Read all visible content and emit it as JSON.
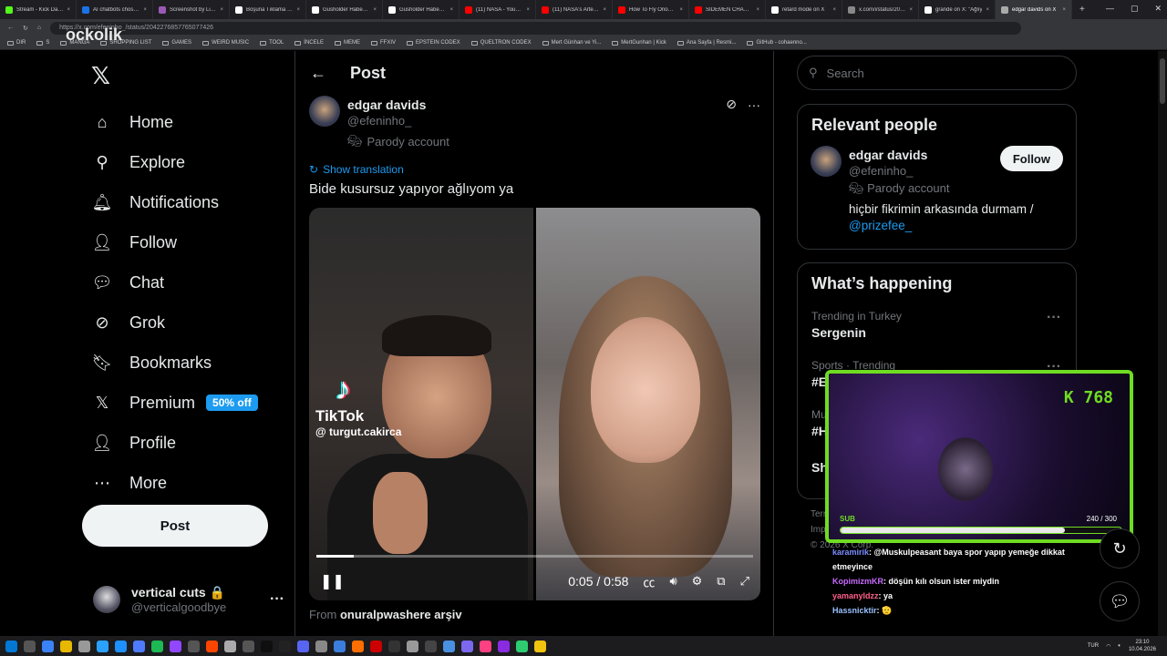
{
  "browser": {
    "tabs": [
      {
        "title": "Stream - Kick Dashb",
        "color": "#53fc18"
      },
      {
        "title": "AI chatbots chose n",
        "color": "#1a73e8"
      },
      {
        "title": "Screenshot by Lightsh",
        "color": "#9b59b6"
      },
      {
        "title": "Boşuna Tıklama on X",
        "color": "#ffffff"
      },
      {
        "title": "Gusholder Haber Bü",
        "color": "#ffffff"
      },
      {
        "title": "Gusholder Haber Bü",
        "color": "#ffffff"
      },
      {
        "title": "(11) NASA - YouTube",
        "color": "#ff0000"
      },
      {
        "title": "(11) NASA's Artemis",
        "color": "#ff0000"
      },
      {
        "title": "How To Fly Orion - Y",
        "color": "#ff0000"
      },
      {
        "title": "SIDEMEN CHARITY M",
        "color": "#ff0000"
      },
      {
        "title": "retard mode on X",
        "color": "#ffffff"
      },
      {
        "title": "x.com/i/status/2042",
        "color": "#888888"
      },
      {
        "title": "grande on X: \"Ağlıy",
        "color": "#ffffff"
      },
      {
        "title": "edgar davids on X",
        "color": "#aaaaaa"
      }
    ],
    "url": "https://x.com/efeninho_/status/2042276857765077426",
    "bookmarks": [
      "DIR",
      "S",
      "MANGA",
      "SHOPPING LIST",
      "GAMES",
      "WEIRD MUSIC",
      "TOOL",
      "İNCELE",
      "MEME",
      "FFXIV",
      "EPSTEIN CODEX",
      "QUELTRON CODEX",
      "Mert Günhan ve Yi...",
      "MertGunhan | Kick",
      "Ana Sayfa | Resmi...",
      "GitHub - cohaenno..."
    ],
    "overlay_logo": "ockolik"
  },
  "sidebar": {
    "logo": "𝕏",
    "items": [
      {
        "label": "Home",
        "icon": "home-icon",
        "glyph": "⌂"
      },
      {
        "label": "Explore",
        "icon": "search-icon",
        "glyph": "⚲"
      },
      {
        "label": "Notifications",
        "icon": "bell-icon",
        "glyph": "🔔︎"
      },
      {
        "label": "Follow",
        "icon": "add-person-icon",
        "glyph": "👤︎"
      },
      {
        "label": "Chat",
        "icon": "chat-icon",
        "glyph": "💬︎"
      },
      {
        "label": "Grok",
        "icon": "grok-icon",
        "glyph": "⊘"
      },
      {
        "label": "Bookmarks",
        "icon": "bookmark-icon",
        "glyph": "🔖︎"
      },
      {
        "label": "Premium",
        "icon": "x-premium-icon",
        "glyph": "𝕏",
        "badge": "50% off"
      },
      {
        "label": "Profile",
        "icon": "profile-icon",
        "glyph": "👤︎"
      },
      {
        "label": "More",
        "icon": "more-circle-icon",
        "glyph": "⋯"
      }
    ],
    "post_button": "Post",
    "account": {
      "name": "vertical cuts 🔒",
      "handle": "@verticalgoodbye",
      "more": "···"
    }
  },
  "post": {
    "header_title": "Post",
    "author_name": "edgar davids",
    "author_handle": "@efeninho_",
    "parody": "Parody account",
    "show_translation": "Show translation",
    "text": "Bide kusursuz yapıyor ağlıyom ya",
    "video": {
      "watermark_brand": "TikTok",
      "watermark_user": "@ turgut.cakirca",
      "time": "0:05 / 0:58",
      "progress": 0.086,
      "state": "playing"
    },
    "from_prefix": "From",
    "from_source": "onuralpwashere arşiv"
  },
  "right": {
    "search_placeholder": "Search",
    "relevant_title": "Relevant people",
    "person": {
      "name": "edgar davids",
      "handle": "@efeninho_",
      "parody": "Parody account",
      "follow": "Follow",
      "bio": "hiçbir fikrimin arkasında durmam /",
      "bio_link": "@prizefee_"
    },
    "happening_title": "What’s happening",
    "trends": [
      {
        "meta": "Trending in Turkey",
        "name": "Sergenin"
      },
      {
        "meta": "Sports · Trending",
        "name": "#E"
      },
      {
        "meta": "Mu",
        "name": "#H"
      },
      {
        "meta": "",
        "name": "Sh"
      }
    ],
    "footer": [
      "Terr",
      "Imp",
      "© 2026 X Corp."
    ]
  },
  "stream_overlay": {
    "viewers": "K 768",
    "sub_label": "SUB",
    "sub_count": "240 / 300",
    "sub_progress": 0.8,
    "accent": "#6fdc22"
  },
  "chat": [
    {
      "user": "karamirik",
      "msg": ": @Muskulpeasant baya spor yapıp yemeğe dikkat etmeyince"
    },
    {
      "user": "KopimizmKR",
      "msg": ": döşün kılı olsun ister miydin"
    },
    {
      "user": "yamanyldzz",
      "msg": ": ya"
    },
    {
      "user": "Hassnicktir",
      "msg": ": 🫡"
    }
  ],
  "taskbar": {
    "lang": "TUR",
    "time": "23:10",
    "date": "10.04.2026"
  }
}
